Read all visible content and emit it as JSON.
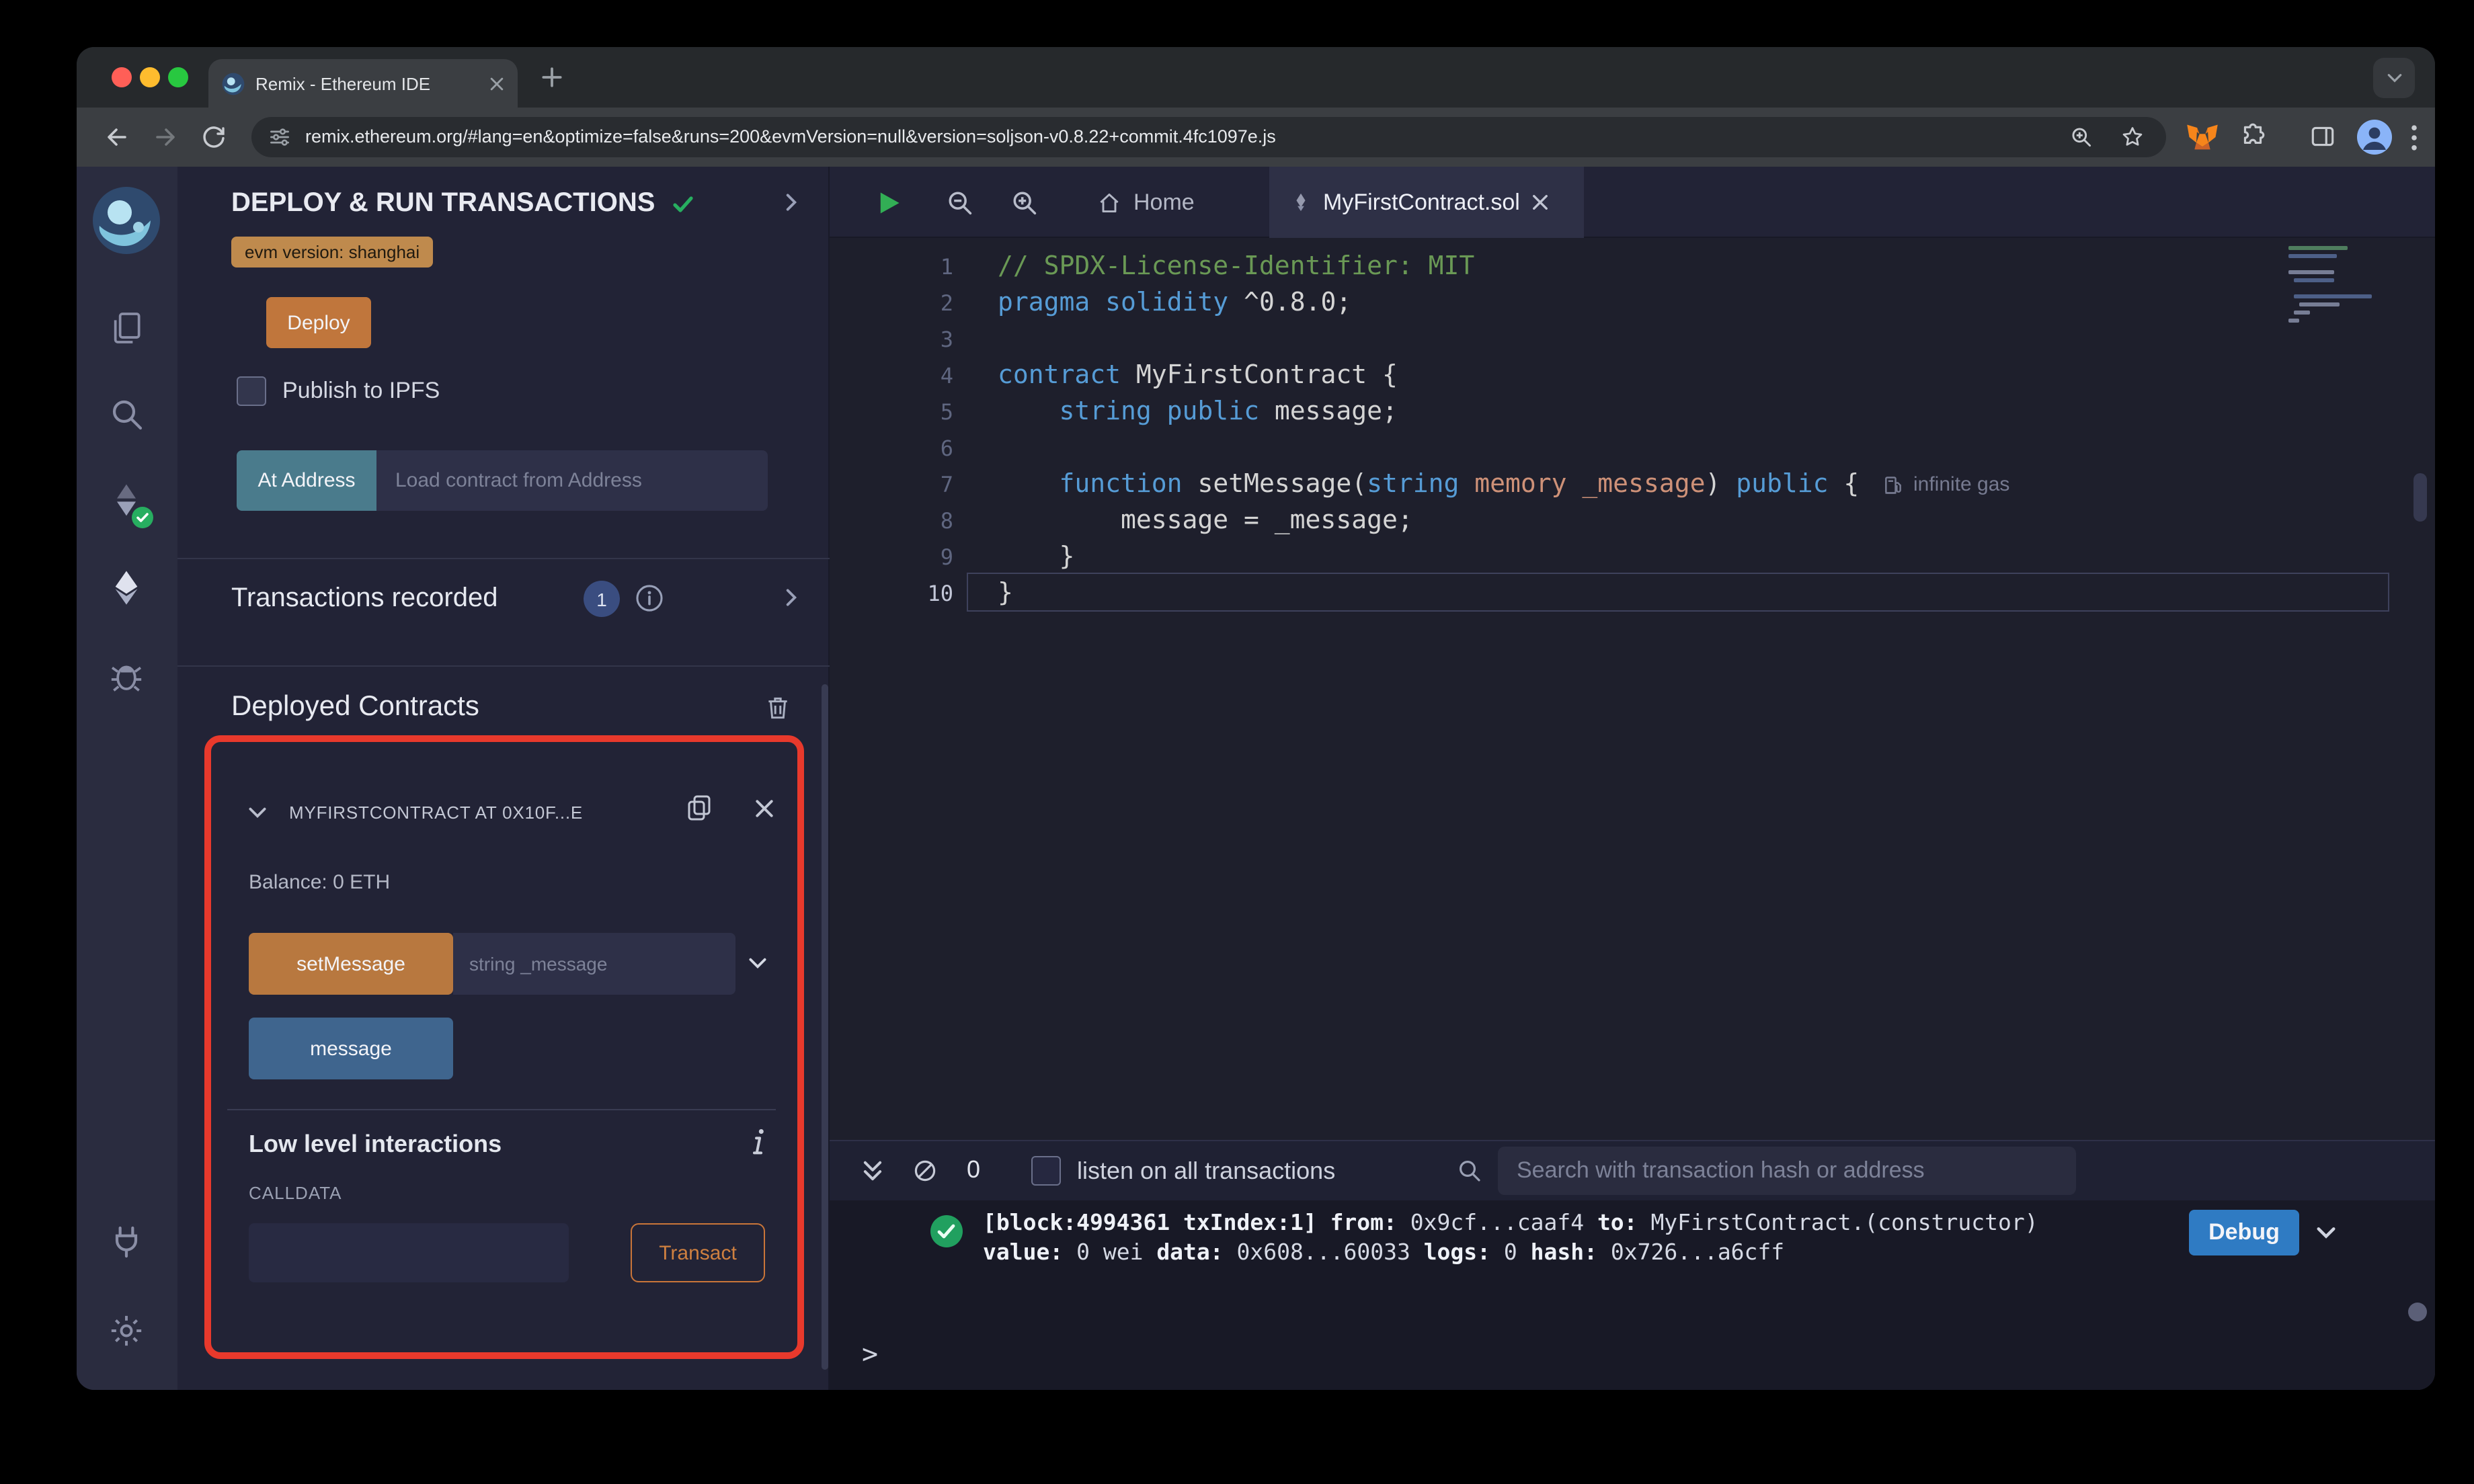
{
  "browser": {
    "tab_title": "Remix - Ethereum IDE",
    "url": "remix.ethereum.org/#lang=en&optimize=false&runs=200&evmVersion=null&version=soljson-v0.8.22+commit.4fc1097e.js"
  },
  "activity_bar": {
    "icons": [
      "remix-logo",
      "file-explorer",
      "search",
      "solidity-compiler",
      "deploy-and-run",
      "debugger",
      "plugin-manager",
      "settings"
    ]
  },
  "deploy_panel": {
    "title": "DEPLOY & RUN TRANSACTIONS",
    "evm_version_badge": "evm version: shanghai",
    "deploy_button": "Deploy",
    "publish_to_ipfs": "Publish to IPFS",
    "at_address_button": "At Address",
    "at_address_placeholder": "Load contract from Address",
    "transactions_recorded_label": "Transactions recorded",
    "transactions_recorded_count": "1",
    "deployed_contracts_title": "Deployed Contracts",
    "deployed_contract": {
      "header": "MYFIRSTCONTRACT AT 0X10F...E",
      "balance": "Balance: 0 ETH",
      "set_message_button": "setMessage",
      "set_message_placeholder": "string _message",
      "message_button": "message",
      "low_level_title": "Low level interactions",
      "calldata_label": "CALLDATA",
      "transact_button": "Transact"
    }
  },
  "editor": {
    "tab_home": "Home",
    "tab_active": "MyFirstContract.sol",
    "gas_annotation": "infinite gas",
    "lines": [
      {
        "n": "1",
        "tokens": [
          {
            "s": "com",
            "t": "// SPDX-License-Identifier: MIT"
          }
        ]
      },
      {
        "n": "2",
        "tokens": [
          {
            "s": "kw",
            "t": "pragma solidity"
          },
          {
            "s": "pl",
            "t": " ^0.8.0;"
          }
        ]
      },
      {
        "n": "3",
        "tokens": []
      },
      {
        "n": "4",
        "tokens": [
          {
            "s": "kw",
            "t": "contract"
          },
          {
            "s": "pl",
            "t": " MyFirstContract {"
          }
        ]
      },
      {
        "n": "5",
        "tokens": [
          {
            "s": "pl",
            "t": "    "
          },
          {
            "s": "kw",
            "t": "string public"
          },
          {
            "s": "pl",
            "t": " message;"
          }
        ]
      },
      {
        "n": "6",
        "tokens": []
      },
      {
        "n": "7",
        "tokens": [
          {
            "s": "pl",
            "t": "    "
          },
          {
            "s": "kw",
            "t": "function"
          },
          {
            "s": "pl",
            "t": " setMessage("
          },
          {
            "s": "kw",
            "t": "string"
          },
          {
            "s": "or",
            "t": " memory _message"
          },
          {
            "s": "pl",
            "t": ") "
          },
          {
            "s": "kw",
            "t": "public"
          },
          {
            "s": "pl",
            "t": " {"
          }
        ]
      },
      {
        "n": "8",
        "tokens": [
          {
            "s": "pl",
            "t": "        message = _message;"
          }
        ]
      },
      {
        "n": "9",
        "tokens": [
          {
            "s": "pl",
            "t": "    }"
          }
        ]
      },
      {
        "n": "10",
        "tokens": [
          {
            "s": "pl",
            "t": "}"
          }
        ]
      }
    ]
  },
  "terminal": {
    "pending_count": "0",
    "listen_label": "listen on all transactions",
    "search_placeholder": "Search with transaction hash or address",
    "debug_button": "Debug",
    "prompt": ">",
    "log": {
      "block": "[block:4994361 txIndex:1] ",
      "from_label": "from: ",
      "from_value": "0x9cf...caaf4 ",
      "to_label": "to: ",
      "to_value": "MyFirstContract.(constructor)",
      "value_label": "value: ",
      "value_value": "0 wei ",
      "data_label": "data: ",
      "data_value": "0x608...60033 ",
      "logs_label": "logs: ",
      "logs_value": "0 ",
      "hash_label": "hash: ",
      "hash_value": "0x726...a6cff"
    }
  },
  "colors": {
    "accent_orange": "#C97539",
    "at_address_teal": "#4A7B8C",
    "call_button_blue": "#3F658E",
    "debug_blue": "#2F7BC3",
    "highlight_red": "#E8392C",
    "success_green": "#27AE60",
    "badge_blue": "#3A4D80"
  }
}
